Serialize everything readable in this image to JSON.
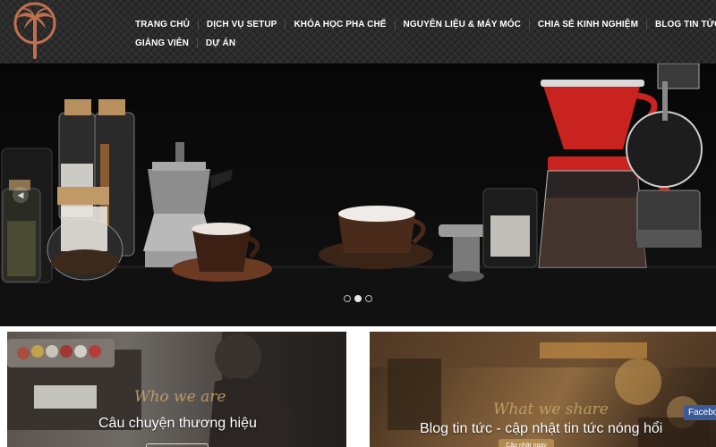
{
  "header": {
    "logo_icon": "palm-tree-logo-icon",
    "brand_color": "#c0704e",
    "nav_row1": [
      "Trang chủ",
      "Dịch vụ Setup",
      "Khóa học pha chế",
      "Nguyên liệu & máy móc",
      "Chia sẻ kinh nghiệm",
      "Blog tin tức"
    ],
    "nav_row2": [
      "Giảng viên",
      "Dự án"
    ]
  },
  "hero": {
    "prev_icon": "chevron-left-icon",
    "prev_glyph": "◀",
    "slide_count": 3,
    "active_slide": 2
  },
  "cards": {
    "left": {
      "script": "Who we are",
      "title": "Câu chuyện thương hiệu"
    },
    "right": {
      "script": "What we share",
      "title": "Blog tin tức - cập nhật tin tức nóng hổi",
      "button": "Cập nhật ngay"
    }
  },
  "social": {
    "facebook_label": "Facebook"
  },
  "colors": {
    "header_bg": "#2b2b2b",
    "accent_red": "#c8231f",
    "script_gold": "#c9a56a",
    "facebook_blue": "#3b5b98"
  }
}
